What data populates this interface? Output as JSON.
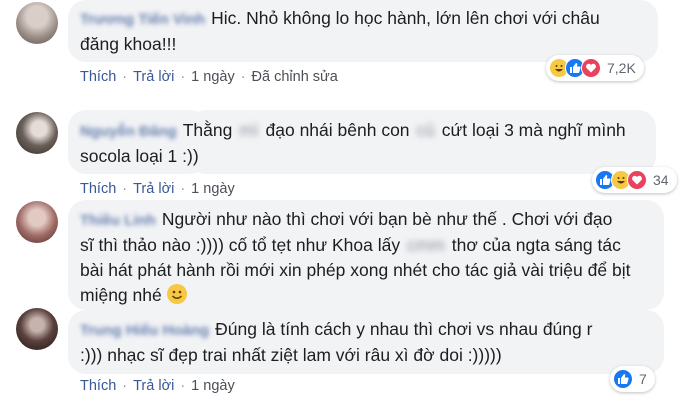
{
  "comments": [
    {
      "author": "Trương Tiến Vinh",
      "lines": [
        "Hic. Nhỏ không lo học hành, lớn lên chơi với châu",
        "đăng khoa!!!"
      ],
      "actions": {
        "like": "Thích",
        "reply": "Trả lời",
        "time": "1 ngày",
        "edited": "Đã chỉnh sửa"
      },
      "reaction_count": "7,2K",
      "reaction_icons": [
        "haha-icon",
        "like-icon",
        "love-icon"
      ]
    },
    {
      "author": "Nguyễn Đăng",
      "line1_a": "Thằng",
      "line1_blur": "mì",
      "line1_b": "đạo nhái bênh con",
      "line1_blur2": "củ",
      "line1_c": "cứt loại 3 mà nghĩ mình",
      "line2": "socola loại 1 :))",
      "actions": {
        "like": "Thích",
        "reply": "Trả lời",
        "time": "1 ngày"
      },
      "reaction_count": "34",
      "reaction_icons": [
        "like-icon",
        "haha-icon",
        "love-icon"
      ]
    },
    {
      "author": "Thiều Linh",
      "lines": [
        "Người như nào thì chơi với bạn bè như thế . Chơi với đạo",
        "sĩ thì thảo nào :)))) cố tổ tẹt như Khoa lấy",
        "bài hát phát hành rồi mới xin phép xong nhét cho tác giả vài triệu để bịt",
        "miệng nhé"
      ],
      "line2_blur": "cmm",
      "line2_tail": "thơ của ngta sáng tác"
    },
    {
      "author": "Trung Hiếu Hoàng",
      "lines": [
        "Đúng là tính cách y nhau thì chơi vs nhau đúng r",
        ":))) nhạc sĩ đẹp trai nhất ziệt lam với râu xì đờ doi :)))))"
      ],
      "actions": {
        "like": "Thích",
        "reply": "Trả lời",
        "time": "1 ngày"
      },
      "reaction_count": "7",
      "reaction_icons": [
        "like-icon"
      ]
    }
  ],
  "colors": {
    "link": "#385898",
    "bubble": "#f2f3f5",
    "like": "#1877f2",
    "haha": "#f7c843",
    "love": "#e8425c"
  }
}
